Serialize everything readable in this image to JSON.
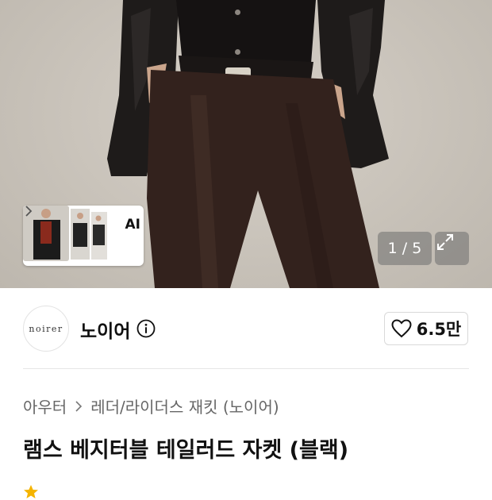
{
  "gallery": {
    "ai_label": "AI",
    "counter": "1 / 5",
    "colors": {
      "background": "#c9c3ba",
      "jacket": "#1c1918",
      "pants": "#3a2620"
    }
  },
  "brand": {
    "logo_text": "noirer",
    "name": "노이어",
    "like_count": "6.5만"
  },
  "breadcrumb": {
    "items": [
      "아우터",
      "레더/라이더스 재킷 (노이어)"
    ]
  },
  "product": {
    "title": "램스 베지터블 테일러드 자켓 (블랙)"
  },
  "icons": [
    "ai-stack",
    "chevron-right-icon",
    "expand-icon",
    "info-icon",
    "heart-icon",
    "star-icon"
  ]
}
